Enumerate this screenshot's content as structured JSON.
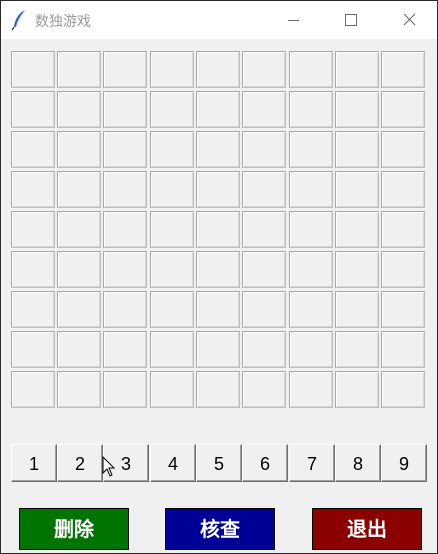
{
  "window": {
    "title": "数独游戏",
    "icons": {
      "app": "feather-icon",
      "minimize": "minimize-icon",
      "maximize": "maximize-icon",
      "close": "close-icon"
    }
  },
  "board": {
    "rows": 9,
    "cols": 9,
    "values": [
      [
        "",
        "",
        "",
        "",
        "",
        "",
        "",
        "",
        ""
      ],
      [
        "",
        "",
        "",
        "",
        "",
        "",
        "",
        "",
        ""
      ],
      [
        "",
        "",
        "",
        "",
        "",
        "",
        "",
        "",
        ""
      ],
      [
        "",
        "",
        "",
        "",
        "",
        "",
        "",
        "",
        ""
      ],
      [
        "",
        "",
        "",
        "",
        "",
        "",
        "",
        "",
        ""
      ],
      [
        "",
        "",
        "",
        "",
        "",
        "",
        "",
        "",
        ""
      ],
      [
        "",
        "",
        "",
        "",
        "",
        "",
        "",
        "",
        ""
      ],
      [
        "",
        "",
        "",
        "",
        "",
        "",
        "",
        "",
        ""
      ],
      [
        "",
        "",
        "",
        "",
        "",
        "",
        "",
        "",
        ""
      ]
    ]
  },
  "numpad": {
    "labels": [
      "1",
      "2",
      "3",
      "4",
      "5",
      "6",
      "7",
      "8",
      "9"
    ]
  },
  "actions": {
    "delete_label": "删除",
    "check_label": "核查",
    "exit_label": "退出"
  },
  "colors": {
    "delete": "#007300",
    "check": "#000096",
    "exit": "#8b0000",
    "window_bg": "#f0f0f0",
    "title_text": "#9a9a9a"
  }
}
